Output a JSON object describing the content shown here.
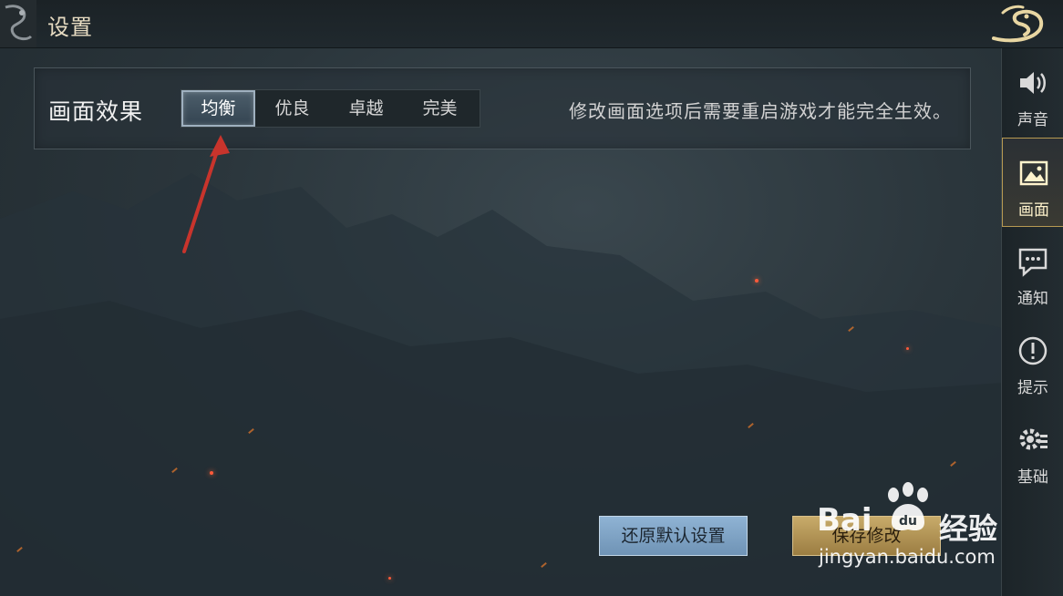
{
  "header": {
    "title": "设置"
  },
  "panel": {
    "label": "画面效果",
    "options": [
      "均衡",
      "优良",
      "卓越",
      "完美"
    ],
    "selected": "均衡",
    "hint": "修改画面选项后需要重启游戏才能完全生效。"
  },
  "sidebar": {
    "items": [
      {
        "label": "声音",
        "icon": "speaker-icon"
      },
      {
        "label": "画面",
        "icon": "picture-icon",
        "active": true
      },
      {
        "label": "通知",
        "icon": "chat-bubble-icon"
      },
      {
        "label": "提示",
        "icon": "exclamation-icon"
      },
      {
        "label": "基础",
        "icon": "gear-icon"
      }
    ]
  },
  "buttons": {
    "reset": "还原默认设置",
    "save": "保存修改"
  },
  "watermark": {
    "brand": "Bai",
    "jingyan": "经验",
    "url": "jingyan.baidu.com"
  },
  "colors": {
    "accent_gold": "#b79a52",
    "selected_tab": "#4c5e6b",
    "arrow": "#c8342c"
  }
}
